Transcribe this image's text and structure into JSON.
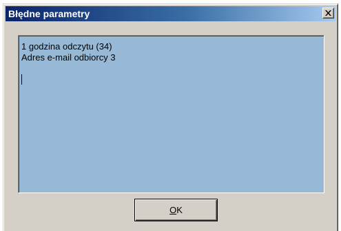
{
  "dialog": {
    "title": "Błędne parametry",
    "close_icon": "close-icon",
    "message_lines": [
      "1 godzina odczytu (34)",
      "Adres e-mail odbiorcy 3"
    ],
    "ok_button": {
      "accel": "O",
      "rest": "K"
    }
  },
  "colors": {
    "titlebar_start": "#0a246a",
    "titlebar_end": "#a6caf0",
    "message_background": "#98b9d6",
    "window_face": "#d4d0c8"
  }
}
